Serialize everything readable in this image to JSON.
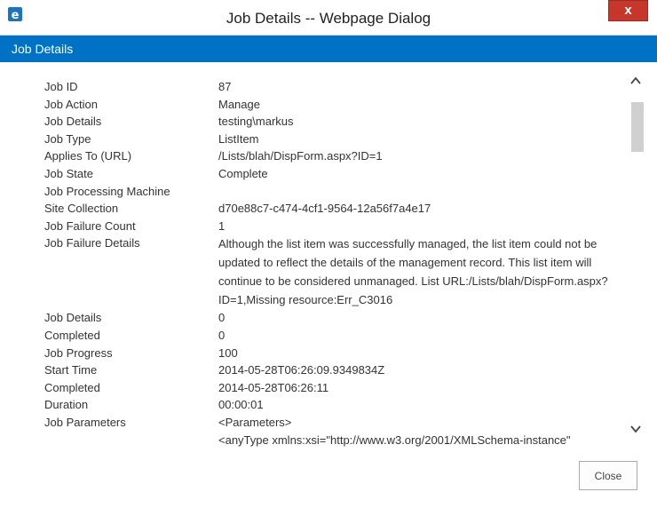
{
  "window": {
    "title": "Job Details -- Webpage Dialog",
    "close_glyph": "x"
  },
  "header": {
    "title": "Job Details"
  },
  "details": [
    {
      "label": "Job ID",
      "value": "87"
    },
    {
      "label": "Job Action",
      "value": "Manage"
    },
    {
      "label": "Job Details",
      "value": "testing\\markus"
    },
    {
      "label": "Job Type",
      "value": "ListItem"
    },
    {
      "label": "Applies To (URL)",
      "value": "/Lists/blah/DispForm.aspx?ID=1"
    },
    {
      "label": "Job State",
      "value": "Complete"
    },
    {
      "label": "Job Processing Machine",
      "value": ""
    },
    {
      "label": "Site Collection",
      "value": "d70e88c7-c474-4cf1-9564-12a56f7a4e17"
    },
    {
      "label": "Job Failure Count",
      "value": "1"
    },
    {
      "label": "Job Failure Details",
      "value": "Although the list item was successfully managed, the list item could not be updated to reflect the details of the management record. This list item will continue to be considered unmanaged. List URL:/Lists/blah/DispForm.aspx?ID=1,Missing resource:Err_C3016"
    },
    {
      "label": "Job Details",
      "value": "0"
    },
    {
      "label": "Completed",
      "value": "0"
    },
    {
      "label": "Job Progress",
      "value": "100"
    },
    {
      "label": "Start Time",
      "value": "2014-05-28T06:26:09.9349834Z"
    },
    {
      "label": "Completed",
      "value": "2014-05-28T06:26:11"
    },
    {
      "label": "Duration",
      "value": "00:00:01"
    },
    {
      "label": "Job Parameters",
      "value": "<Parameters>"
    },
    {
      "label": "",
      "value": " <anyType xmlns:xsi=\"http://www.w3.org/2001/XMLSchema-instance\""
    }
  ],
  "footer": {
    "close_label": "Close"
  },
  "icons": {
    "app": "ie-icon",
    "scroll_up": "chevron-up-icon",
    "scroll_down": "chevron-down-icon"
  },
  "colors": {
    "header_bg": "#0072c6",
    "close_x_bg": "#c7362a"
  }
}
